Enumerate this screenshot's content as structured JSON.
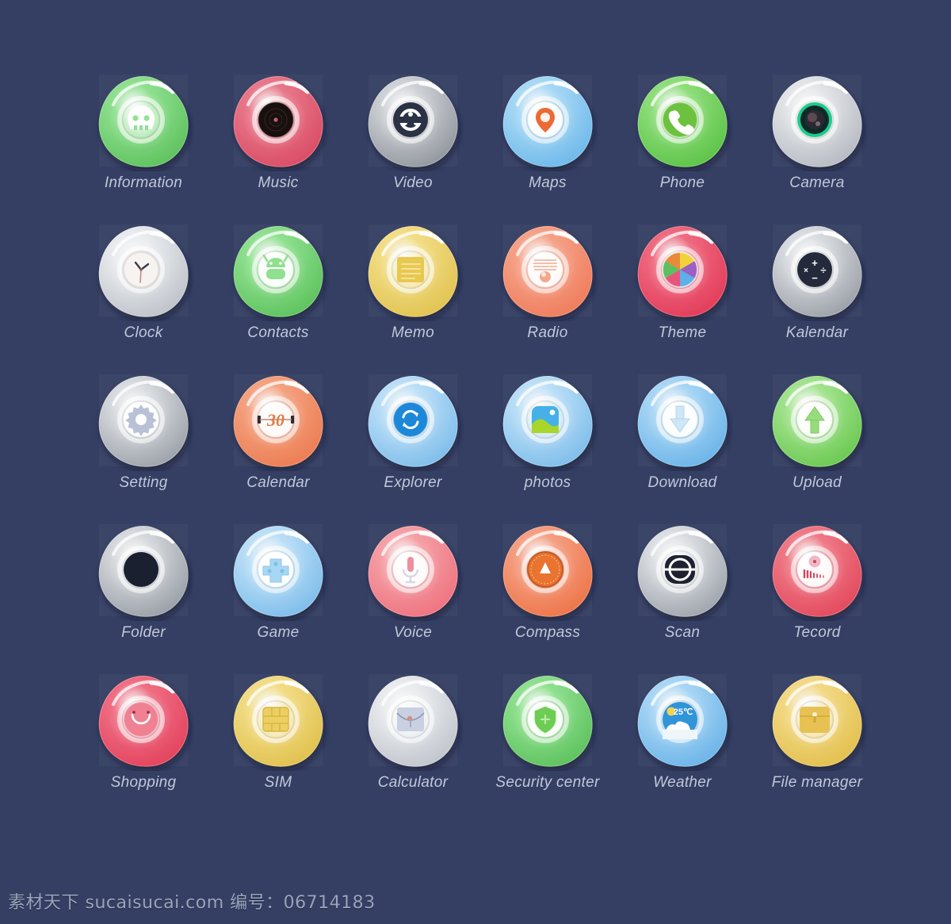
{
  "page": {
    "background_color": "#343f63",
    "tile_color": "rgba(255,255,255,0.035)",
    "label_color": "#c2c8da",
    "columns": 6,
    "rows": 5
  },
  "icons": [
    {
      "label": "Information",
      "glyph": "skull-icon",
      "blob": "#8fe08f",
      "blob_dark": "#5cc15c",
      "inner": "light-ring",
      "badge": ""
    },
    {
      "label": "Music",
      "glyph": "vinyl-record-icon",
      "blob": "#e8788a",
      "blob_dark": "#d94a63",
      "inner": "dark-disc",
      "badge": ""
    },
    {
      "label": "Video",
      "glyph": "film-reel-icon",
      "blob": "#cfd2d6",
      "blob_dark": "#8f949c",
      "inner": "dark-disc",
      "badge": ""
    },
    {
      "label": "Maps",
      "glyph": "map-pin-icon",
      "blob": "#a9d9f5",
      "blob_dark": "#6bb8ea",
      "inner": "light-ring",
      "badge": ""
    },
    {
      "label": "Phone",
      "glyph": "handset-icon",
      "blob": "#8ede7a",
      "blob_dark": "#5bc246",
      "inner": "green-disc",
      "badge": ""
    },
    {
      "label": "Camera",
      "glyph": "camera-lens-icon",
      "blob": "#e3e5e8",
      "blob_dark": "#b5b9c0",
      "inner": "lens-disc",
      "badge": ""
    },
    {
      "label": "Clock",
      "glyph": "analog-clock-icon",
      "blob": "#e9ebee",
      "blob_dark": "#bcc1c8",
      "inner": "light-ring",
      "badge": ""
    },
    {
      "label": "Contacts",
      "glyph": "android-head-icon",
      "blob": "#8fe08f",
      "blob_dark": "#5cc15c",
      "inner": "light-ring",
      "badge": ""
    },
    {
      "label": "Memo",
      "glyph": "note-lines-icon",
      "blob": "#f2dd86",
      "blob_dark": "#e0c24e",
      "inner": "yellow-sq",
      "badge": ""
    },
    {
      "label": "Radio",
      "glyph": "radio-grille-icon",
      "blob": "#f5a288",
      "blob_dark": "#ef7b5a",
      "inner": "light-ring",
      "badge": ""
    },
    {
      "label": "Theme",
      "glyph": "color-wheel-icon",
      "blob": "#ef6a80",
      "blob_dark": "#e23a58",
      "inner": "rainbow",
      "badge": ""
    },
    {
      "label": "Kalendar",
      "glyph": "calculator-keys-icon",
      "blob": "#d9dce0",
      "blob_dark": "#999ea6",
      "inner": "dark-disc",
      "badge": ""
    },
    {
      "label": "Setting",
      "glyph": "gear-icon",
      "blob": "#d8dbdf",
      "blob_dark": "#9aa0a8",
      "inner": "light-ring",
      "badge": ""
    },
    {
      "label": "Calendar",
      "glyph": "date-number-icon",
      "blob": "#f4a281",
      "blob_dark": "#ec7b50",
      "inner": "light-ring",
      "badge": "30"
    },
    {
      "label": "Explorer",
      "glyph": "refresh-circle-icon",
      "blob": "#bcdff7",
      "blob_dark": "#7cbcea",
      "inner": "blue-disc",
      "badge": ""
    },
    {
      "label": "photos",
      "glyph": "landscape-photo-icon",
      "blob": "#bcdff7",
      "blob_dark": "#7cbcea",
      "inner": "photo-disc",
      "badge": ""
    },
    {
      "label": "Download",
      "glyph": "arrow-down-icon",
      "blob": "#a9d6f5",
      "blob_dark": "#69b3e8",
      "inner": "light-ring",
      "badge": ""
    },
    {
      "label": "Upload",
      "glyph": "arrow-up-icon",
      "blob": "#a3e38f",
      "blob_dark": "#69c84f",
      "inner": "light-ring",
      "badge": ""
    },
    {
      "label": "Folder",
      "glyph": "folder-hole-icon",
      "blob": "#d6d9dd",
      "blob_dark": "#979da5",
      "inner": "dark-hole",
      "badge": ""
    },
    {
      "label": "Game",
      "glyph": "gamepad-icon",
      "blob": "#bcdff7",
      "blob_dark": "#7cbcea",
      "inner": "light-ring",
      "badge": ""
    },
    {
      "label": "Voice",
      "glyph": "microphone-icon",
      "blob": "#f5a0a6",
      "blob_dark": "#ee717e",
      "inner": "light-ring",
      "badge": ""
    },
    {
      "label": "Compass",
      "glyph": "compass-needle-icon",
      "blob": "#f5a084",
      "blob_dark": "#ed7346",
      "inner": "orange-disc",
      "badge": ""
    },
    {
      "label": "Scan",
      "glyph": "scanner-icon",
      "blob": "#dcdfe3",
      "blob_dark": "#9ca2aa",
      "inner": "dark-disc",
      "badge": ""
    },
    {
      "label": "Tecord",
      "glyph": "sound-wave-icon",
      "blob": "#ef7a86",
      "blob_dark": "#e2485c",
      "inner": "light-ring",
      "badge": ""
    },
    {
      "label": "Shopping",
      "glyph": "smile-bag-icon",
      "blob": "#ef6f84",
      "blob_dark": "#e3415c",
      "inner": "pink-disc",
      "badge": ""
    },
    {
      "label": "SIM",
      "glyph": "sim-chip-icon",
      "blob": "#f2dc85",
      "blob_dark": "#e0c04c",
      "inner": "light-ring",
      "badge": ""
    },
    {
      "label": "Calculator",
      "glyph": "abacus-icon",
      "blob": "#e9ebee",
      "blob_dark": "#bfc4cb",
      "inner": "grey-disc",
      "badge": ""
    },
    {
      "label": "Security center",
      "glyph": "shield-icon",
      "blob": "#8fe08f",
      "blob_dark": "#5cc15c",
      "inner": "green-shield",
      "badge": ""
    },
    {
      "label": "Weather",
      "glyph": "sun-cloud-icon",
      "blob": "#a9d6f5",
      "blob_dark": "#69b3e8",
      "inner": "sky-disc",
      "badge": "25℃"
    },
    {
      "label": "File manager",
      "glyph": "file-drawer-icon",
      "blob": "#f2d985",
      "blob_dark": "#e2bf4c",
      "inner": "yellow-disc",
      "badge": ""
    }
  ],
  "footer": {
    "text": "素材天下 sucaisucai.com  编号：06714183",
    "site": "sucaisucai.com",
    "id": "06714183"
  }
}
